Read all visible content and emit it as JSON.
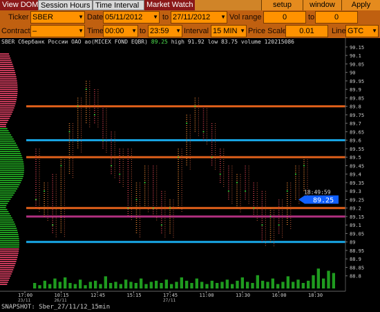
{
  "tabs": [
    {
      "label": "View DOM",
      "style": "dark"
    },
    {
      "label": "Session Hours",
      "style": "light"
    },
    {
      "label": "Time Interval",
      "style": "light"
    },
    {
      "label": "Market Watch",
      "style": "dark"
    }
  ],
  "top_buttons": {
    "setup": "setup",
    "window": "window",
    "apply": "Apply"
  },
  "row1": {
    "ticker_label": "Ticker",
    "ticker_value": "SBER",
    "date_label": "Date",
    "date_from": "05/11/2012",
    "to_label": "to",
    "date_to": "27/11/2012",
    "vol_label": "Vol range",
    "vol_from": "0",
    "vol_to_label": "to",
    "vol_to": "0"
  },
  "row2": {
    "contract_label": "Contract",
    "contract_value": "–",
    "time_label": "Time",
    "time_from": "00:00",
    "to_label": "to",
    "time_to": "23:59",
    "interval_label": "Interval",
    "interval_value": "15 MIN",
    "price_scale_label": "Price Scale",
    "price_scale_value": "0.01",
    "line_label": "Line",
    "line_value": "GTC"
  },
  "header": {
    "symbol": "SBER",
    "name": "Сбербанк России ОАО ао(MICEX FOND EQBR)",
    "last": "89.25",
    "high_label": "high",
    "high": "91.92",
    "low_label": "low",
    "low": "83.75",
    "volume_label": "volume",
    "volume": "120215086"
  },
  "current": {
    "time": "18:49:59",
    "price": "89.25"
  },
  "footer": "SNAPSHOT: Sber_27/11/12_15min",
  "colors": {
    "orange": "#e0601a",
    "cyan": "#18a8e8",
    "magenta": "#b03080",
    "green": "#1f9b1f",
    "up": "#3ce03c",
    "down": "#e04040"
  },
  "chart_data": {
    "type": "bar",
    "ylim": [
      88.75,
      90.17
    ],
    "y_ticks": [
      "90.15",
      "90.1",
      "90.05",
      "90",
      "89.95",
      "89.9",
      "89.85",
      "89.8",
      "89.75",
      "89.7",
      "89.65",
      "89.6",
      "89.55",
      "89.5",
      "89.45",
      "89.4",
      "89.35",
      "89.3",
      "89.25",
      "89.2",
      "89.15",
      "89.1",
      "89.05",
      "89",
      "88.95",
      "88.9",
      "88.85",
      "88.8"
    ],
    "x_ticks": [
      {
        "t": "17:00",
        "sub": "23/11"
      },
      {
        "t": "10:15",
        "sub": "26/11"
      },
      {
        "t": "12:45",
        "sub": ""
      },
      {
        "t": "15:15",
        "sub": ""
      },
      {
        "t": "17:45",
        "sub": "27/11"
      },
      {
        "t": "11:00",
        "sub": ""
      },
      {
        "t": "13:30",
        "sub": ""
      },
      {
        "t": "16:00",
        "sub": ""
      },
      {
        "t": "18:30",
        "sub": ""
      }
    ],
    "levels": [
      {
        "price": 89.8,
        "label": "89.8",
        "color": "orange"
      },
      {
        "price": 89.6,
        "label": "89.6",
        "color": "cyan"
      },
      {
        "price": 89.5,
        "label": "89.5",
        "color": "orange"
      },
      {
        "price": 89.2,
        "label": "89.2",
        "color": "orange"
      },
      {
        "price": 89.15,
        "label": "89.15",
        "color": "magenta"
      },
      {
        "price": 89.0,
        "label": "89",
        "color": "cyan"
      }
    ],
    "bars": [
      [
        0,
        89.55,
        89.2,
        89.3,
        89.25
      ],
      [
        0.6,
        89.35,
        89.15,
        89.25,
        89.3
      ],
      [
        1.2,
        89.4,
        89.05,
        89.3,
        89.1
      ],
      [
        1.8,
        89.5,
        89.05,
        89.1,
        89.45
      ],
      [
        2.4,
        89.7,
        89.4,
        89.45,
        89.65
      ],
      [
        3.0,
        89.85,
        89.55,
        89.65,
        89.8
      ],
      [
        3.6,
        89.95,
        89.7,
        89.8,
        89.9
      ],
      [
        4.2,
        89.9,
        89.7,
        89.9,
        89.75
      ],
      [
        4.8,
        89.8,
        89.55,
        89.75,
        89.6
      ],
      [
        5.4,
        89.65,
        89.4,
        89.6,
        89.45
      ],
      [
        6.0,
        89.55,
        89.35,
        89.45,
        89.4
      ],
      [
        6.6,
        89.55,
        89.15,
        89.4,
        89.2
      ],
      [
        7.2,
        89.35,
        89.05,
        89.2,
        89.25
      ],
      [
        7.8,
        89.45,
        89.2,
        89.25,
        89.35
      ],
      [
        8.4,
        89.45,
        89.15,
        89.35,
        89.2
      ],
      [
        9.0,
        89.3,
        89.05,
        89.2,
        89.1
      ],
      [
        9.6,
        89.25,
        89.05,
        89.1,
        89.2
      ],
      [
        10.2,
        89.55,
        89.2,
        89.2,
        89.5
      ],
      [
        10.8,
        89.75,
        89.45,
        89.5,
        89.7
      ],
      [
        11.4,
        89.85,
        89.65,
        89.7,
        89.8
      ],
      [
        12.0,
        89.8,
        89.6,
        89.8,
        89.65
      ],
      [
        12.6,
        89.7,
        89.45,
        89.65,
        89.5
      ],
      [
        13.2,
        89.55,
        89.35,
        89.5,
        89.4
      ],
      [
        13.8,
        89.45,
        89.25,
        89.4,
        89.3
      ],
      [
        14.4,
        89.4,
        89.2,
        89.3,
        89.35
      ],
      [
        15.0,
        89.45,
        89.25,
        89.35,
        89.3
      ],
      [
        15.6,
        89.35,
        89.15,
        89.3,
        89.2
      ],
      [
        16.2,
        89.3,
        89.0,
        89.2,
        89.1
      ],
      [
        16.8,
        89.2,
        89.0,
        89.1,
        89.15
      ],
      [
        17.4,
        89.25,
        89.05,
        89.15,
        89.1
      ],
      [
        18.0,
        89.35,
        89.1,
        89.1,
        89.3
      ],
      [
        18.6,
        89.45,
        89.25,
        89.3,
        89.4
      ],
      [
        19.2,
        89.5,
        89.3,
        89.4,
        89.45
      ]
    ],
    "volume": [
      0.25,
      0.15,
      0.35,
      0.2,
      0.45,
      0.3,
      0.5,
      0.25,
      0.2,
      0.4,
      0.15,
      0.3,
      0.35,
      0.2,
      0.55,
      0.25,
      0.3,
      0.2,
      0.4,
      0.3,
      0.25,
      0.45,
      0.2,
      0.3,
      0.35,
      0.25,
      0.4,
      0.2,
      0.3,
      0.5,
      0.35,
      0.25,
      0.45,
      0.3,
      0.2,
      0.35,
      0.25,
      0.3,
      0.4,
      0.2,
      0.35,
      0.5,
      0.3,
      0.25,
      0.6,
      0.35,
      0.3,
      0.45,
      0.2,
      0.3,
      0.55,
      0.3,
      0.4,
      0.25,
      0.35,
      0.6,
      0.9,
      0.45,
      0.8,
      0.7
    ]
  }
}
